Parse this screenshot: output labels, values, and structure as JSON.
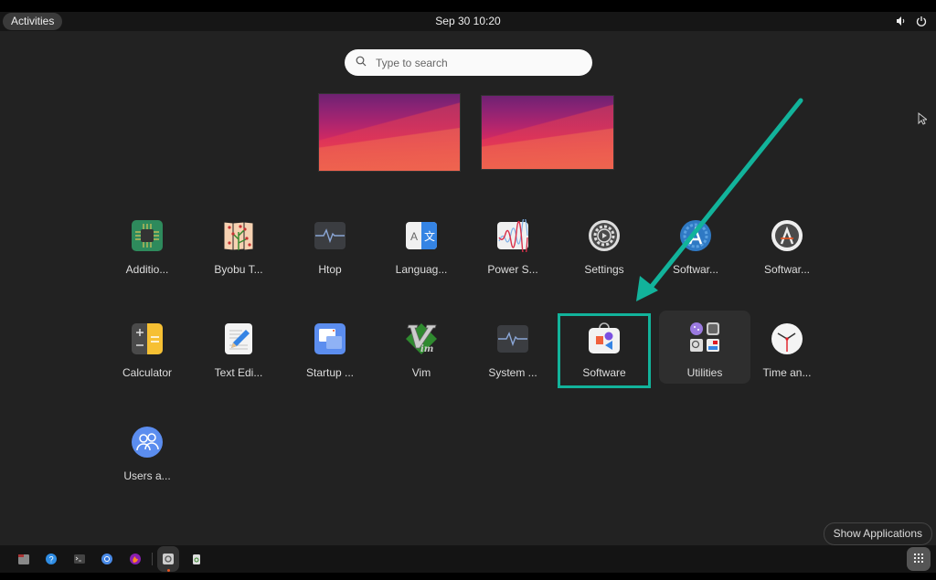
{
  "topbar": {
    "activities_label": "Activities",
    "clock": "Sep 30  10:20",
    "tray_icons": [
      "volume-icon",
      "power-icon"
    ]
  },
  "search": {
    "placeholder": "Type to search",
    "value": ""
  },
  "workspaces": [
    {
      "name": "workspace-1"
    },
    {
      "name": "workspace-2"
    }
  ],
  "apps": [
    {
      "label": "Additio...",
      "icon": "chip-icon"
    },
    {
      "label": "Byobu T...",
      "icon": "byobu-icon"
    },
    {
      "label": "Htop",
      "icon": "htop-icon"
    },
    {
      "label": "Languag...",
      "icon": "language-icon"
    },
    {
      "label": "Power S...",
      "icon": "power-stats-icon"
    },
    {
      "label": "Settings",
      "icon": "settings-gear-icon"
    },
    {
      "label": "Softwar...",
      "icon": "software-updater-icon"
    },
    {
      "label": "Softwar...",
      "icon": "software-properties-icon"
    },
    {
      "label": "Calculator",
      "icon": "calculator-icon"
    },
    {
      "label": "Text Edi...",
      "icon": "text-editor-icon"
    },
    {
      "label": "Startup ...",
      "icon": "startup-apps-icon"
    },
    {
      "label": "Vim",
      "icon": "vim-icon"
    },
    {
      "label": "System ...",
      "icon": "system-monitor-icon"
    },
    {
      "label": "Software",
      "icon": "software-store-icon"
    },
    {
      "label": "Utilities",
      "icon": "utilities-folder-icon"
    },
    {
      "label": "Time an...",
      "icon": "clock-icon"
    },
    {
      "label": "Users a...",
      "icon": "users-icon"
    }
  ],
  "show_applications_label": "Show Applications",
  "dock": {
    "items": [
      "files-icon",
      "help-icon",
      "terminal-icon",
      "chromium-icon",
      "firefox-icon",
      "software-center-icon",
      "trash-icon"
    ],
    "app_grid_icon": "app-grid-icon"
  },
  "annotation": {
    "highlight_color": "#12b39b",
    "target": "Software"
  }
}
